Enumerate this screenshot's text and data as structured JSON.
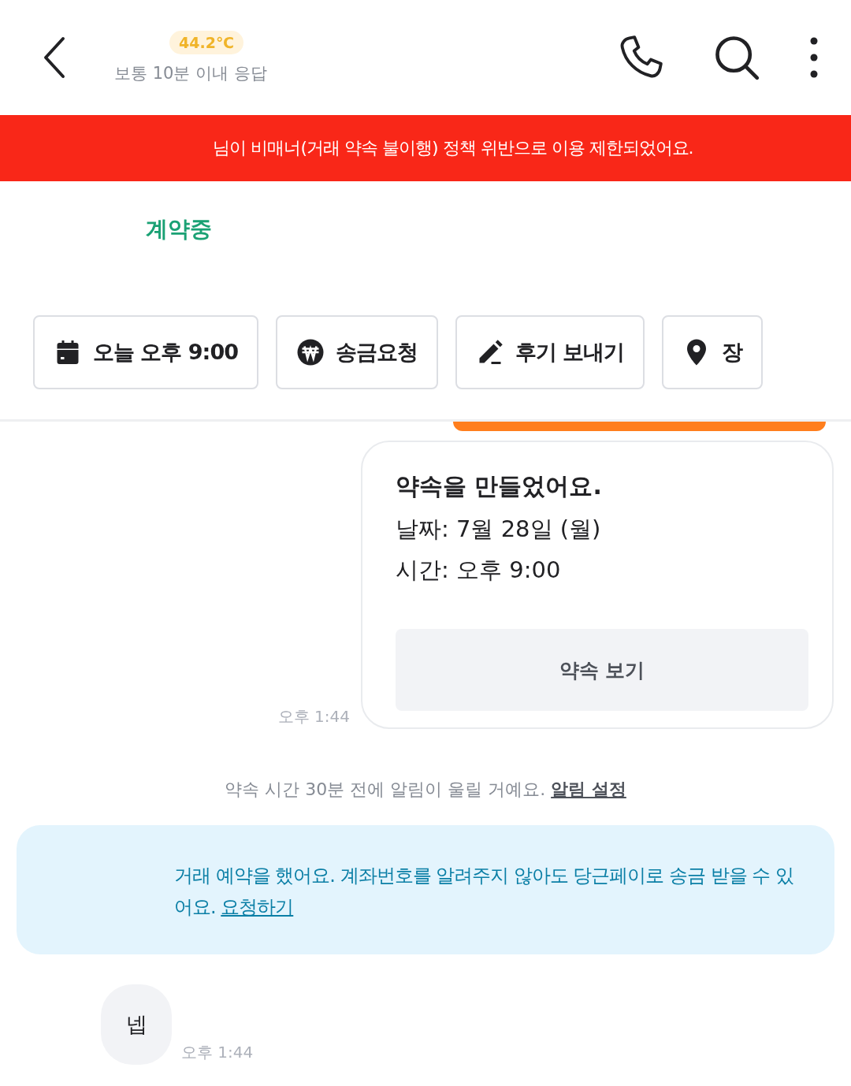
{
  "header": {
    "temperature": "44.2℃",
    "response_time": "보통 10분 이내 응답"
  },
  "banner": {
    "text": "님이 비매너(거래 약속 불이행) 정책 위반으로 이용 제한되었어요."
  },
  "product": {
    "status": "계약중"
  },
  "chips": [
    {
      "kind": "calendar",
      "label": "오늘 오후 9:00"
    },
    {
      "kind": "won",
      "label": "송금요청"
    },
    {
      "kind": "pen",
      "label": "후기 보내기"
    },
    {
      "kind": "pin",
      "label": "장"
    }
  ],
  "appointment_card": {
    "title": "약속을 만들었어요.",
    "date": "날짜: 7월 28일 (월)",
    "time": "시간: 오후 9:00",
    "button": "약속 보기",
    "sent_time": "오후 1:44"
  },
  "notice": {
    "text": "약속 시간 30분 전에 알림이 울릴 거예요.",
    "link": "알림 설정"
  },
  "info_box": {
    "text": "거래 예약을 했어요. 계좌번호를 알려주지 않아도 당근페이로 송금 받을 수 있어요.",
    "link": "요청하기"
  },
  "received_message": {
    "text": "넵",
    "time": "오후 1:44"
  }
}
